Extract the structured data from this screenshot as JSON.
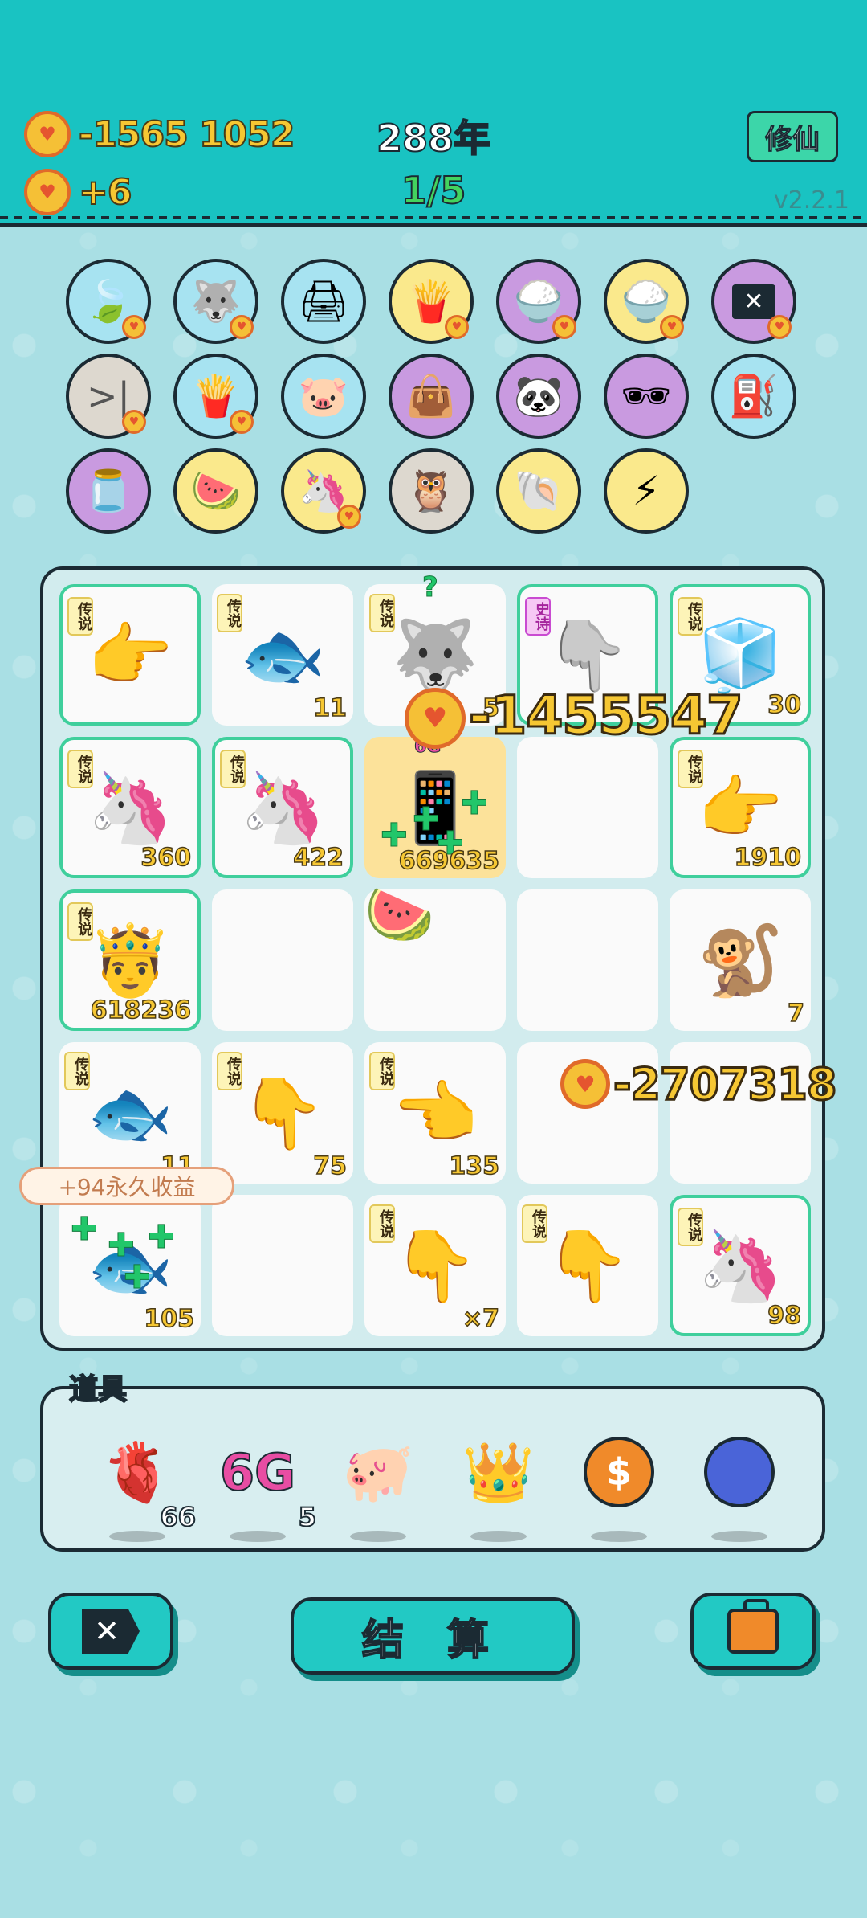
{
  "header": {
    "coins_total": "-1565 1052",
    "coins_rate": "+6",
    "year": "288年",
    "level": "1/5",
    "mode_button": "修仙",
    "version": "v2.2.1"
  },
  "items_row1": [
    "leaf-icon",
    "husky-icon",
    "printer-icon",
    "fries-icon",
    "rice-bowl-icon",
    "rice-bowl-icon",
    "close-tag-icon"
  ],
  "items_row2": [
    "skip-icon",
    "fries-icon",
    "piggy-bank-icon",
    "bag-icon",
    "panda-icon",
    "eyepatch-icon",
    "pump-icon"
  ],
  "items_row3": [
    "jar-icon",
    "fruit-platter-icon",
    "unicorn-icon",
    "owl-icon",
    "shell-icon",
    "lightning-icon"
  ],
  "board": {
    "tag_legend": "传说",
    "tag_epic": "史诗",
    "cells": [
      {
        "icon": "pointing-hand-icon",
        "tag": "传说",
        "count": ""
      },
      {
        "icon": "koi-fish-icon",
        "tag": "传说",
        "count": "11"
      },
      {
        "icon": "husky-king-icon",
        "tag": "传说",
        "count": "5"
      },
      {
        "icon": "pointing-hand-grey-icon",
        "tag": "史诗",
        "count": ""
      },
      {
        "icon": "fridge-icon",
        "tag": "传说",
        "count": "30"
      },
      {
        "icon": "unicorn-icon",
        "tag": "传说",
        "count": "360"
      },
      {
        "icon": "unicorn-icon",
        "tag": "传说",
        "count": "422"
      },
      {
        "icon": "phone-6g-icon",
        "tag": "",
        "count": "669635"
      },
      {
        "icon": "",
        "tag": "",
        "count": ""
      },
      {
        "icon": "pointing-hand-icon",
        "tag": "传说",
        "count": "1910"
      },
      {
        "icon": "king-face-icon",
        "tag": "传说",
        "count": "618236"
      },
      {
        "icon": "",
        "tag": "",
        "count": ""
      },
      {
        "icon": "watermelon-icon",
        "tag": "",
        "count": ""
      },
      {
        "icon": "",
        "tag": "",
        "count": ""
      },
      {
        "icon": "monkey-icon",
        "tag": "",
        "count": "7"
      },
      {
        "icon": "koi-fish-icon",
        "tag": "传说",
        "count": "11"
      },
      {
        "icon": "pointing-hand-icon",
        "tag": "传说",
        "count": "75"
      },
      {
        "icon": "pointing-hand-icon",
        "tag": "传说",
        "count": "135"
      },
      {
        "icon": "",
        "tag": "",
        "count": ""
      },
      {
        "icon": "",
        "tag": "",
        "count": ""
      },
      {
        "icon": "koi-fish-icon",
        "tag": "",
        "count": "105"
      },
      {
        "icon": "",
        "tag": "",
        "count": ""
      },
      {
        "icon": "pointing-hand-icon",
        "tag": "传说",
        "count": "×7"
      },
      {
        "icon": "pointing-hand-icon",
        "tag": "传说",
        "count": ""
      },
      {
        "icon": "unicorn-icon",
        "tag": "传说",
        "count": "98"
      }
    ],
    "question_mark": "?",
    "badge_6g": "6G",
    "float_1": "-1455547",
    "float_2": "-2707318",
    "tooltip": "+94永久收益"
  },
  "tools": {
    "title": "道具",
    "items": [
      {
        "icon": "liver-icon",
        "count": "66"
      },
      {
        "icon": "6g-icon",
        "label": "6G",
        "count": "5"
      },
      {
        "icon": "piggy-bank-icon",
        "count": ""
      },
      {
        "icon": "crown-icon",
        "count": ""
      },
      {
        "icon": "dollar-coin-icon",
        "count": ""
      },
      {
        "icon": "blueberry-icon",
        "count": ""
      }
    ]
  },
  "buttons": {
    "settle": "结 算"
  }
}
